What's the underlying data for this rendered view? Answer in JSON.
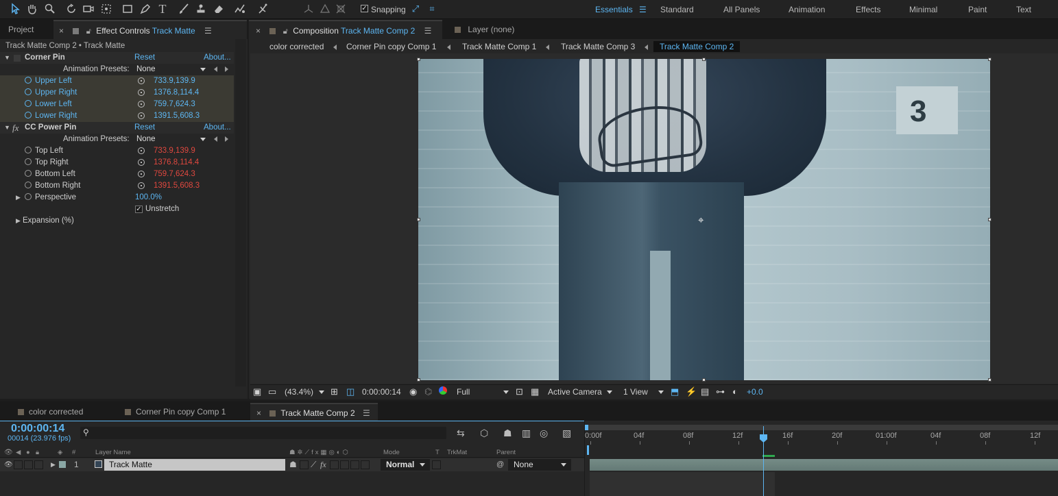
{
  "toolbar": {
    "icons": [
      "selection-tool-icon",
      "hand-tool-icon",
      "zoom-tool-icon",
      "rotation-tool-icon",
      "camera-tool-icon",
      "pan-behind-tool-icon",
      "rectangle-tool-icon",
      "pen-tool-icon",
      "type-tool-icon",
      "brush-tool-icon",
      "clone-stamp-tool-icon",
      "eraser-tool-icon",
      "roto-brush-tool-icon",
      "puppet-tool-icon",
      "local-axis-icon",
      "world-axis-icon",
      "view-axis-icon"
    ],
    "snapping_label": "Snapping",
    "snapping_checked": true,
    "workspaces": [
      "Essentials",
      "Standard",
      "All Panels",
      "Animation",
      "Effects",
      "Minimal",
      "Paint",
      "Text"
    ],
    "active_workspace": "Essentials"
  },
  "left_panel": {
    "tab_project": "Project",
    "tab_effect_controls": "Effect Controls",
    "tab_effect_layer": "Track Matte",
    "crumb": "Track Matte Comp 2 • Track Matte",
    "reset": "Reset",
    "about": "About...",
    "anim_presets_label": "Animation Presets:",
    "anim_presets_value": "None",
    "corner_pin": {
      "name": "Corner Pin",
      "props": [
        {
          "name": "Upper Left",
          "value": "733.9,139.9"
        },
        {
          "name": "Upper Right",
          "value": "1376.8,114.4"
        },
        {
          "name": "Lower Left",
          "value": "759.7,624.3"
        },
        {
          "name": "Lower Right",
          "value": "1391.5,608.3"
        }
      ]
    },
    "cc_power_pin": {
      "name": "CC Power Pin",
      "props": [
        {
          "name": "Top Left",
          "value": "733.9,139.9"
        },
        {
          "name": "Top Right",
          "value": "1376.8,114.4"
        },
        {
          "name": "Bottom Left",
          "value": "759.7,624.3"
        },
        {
          "name": "Bottom Right",
          "value": "1391.5,608.3"
        }
      ],
      "perspective_label": "Perspective",
      "perspective_value": "100.0%",
      "unstretch_label": "Unstretch",
      "unstretch_checked": true,
      "expansion_label": "Expansion (%)"
    }
  },
  "comp_panel": {
    "tab_composition": "Composition",
    "tab_comp_name": "Track Matte Comp 2",
    "tab_layer": "Layer (none)",
    "flowchart": [
      "color corrected",
      "Corner Pin copy  Comp 1",
      "Track Matte Comp 1",
      "Track Matte Comp 3",
      "Track Matte Comp 2"
    ],
    "active_flow": "Track Matte Comp 2",
    "footer": {
      "zoom": "(43.4%)",
      "timecode": "0:00:00:14",
      "resolution": "Full",
      "camera": "Active Camera",
      "views": "1 View",
      "exposure": "+0.0"
    },
    "viewer_number": "3"
  },
  "timeline": {
    "tabs": [
      "color corrected",
      "Corner Pin copy  Comp 1",
      "Track Matte Comp 2"
    ],
    "active_tab": "Track Matte Comp 2",
    "timecode": "0:00:00:14",
    "frames": "00014 (23.976 fps)",
    "search_placeholder": "",
    "ruler": [
      "0:00f",
      "04f",
      "08f",
      "12f",
      "16f",
      "20f",
      "01:00f",
      "04f",
      "08f",
      "12f"
    ],
    "columns": {
      "num": "#",
      "layer_name": "Layer Name",
      "mode": "Mode",
      "t": "T",
      "trkmat": "TrkMat",
      "parent": "Parent"
    },
    "layers": [
      {
        "num": "1",
        "name": "Track Matte",
        "mode": "Normal",
        "parent": "None"
      }
    ]
  }
}
